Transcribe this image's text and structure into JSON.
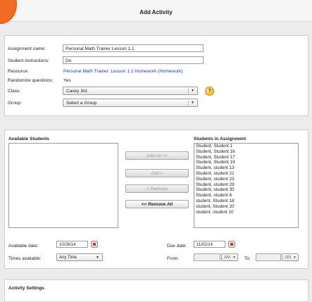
{
  "header": {
    "title": "Add Activity"
  },
  "form": {
    "assignment_name_label": "Assignment name:",
    "assignment_name_value": "Personal Math Trainer Lesson 1.1",
    "student_instructions_label": "Student instructions:",
    "student_instructions_value": "Do",
    "resource_label": "Resource:",
    "resource_value": "Personal Math Trainer: Lesson 1.1 Homework (Homework)",
    "randomize_label": "Randomize questions:",
    "randomize_value": "Yes",
    "class_label": "Class:",
    "class_value": "Casey 3rd",
    "group_label": "Group:",
    "group_value": "Select a Group",
    "help_icon": "?"
  },
  "students": {
    "available_title": "Available Students",
    "assigned_title": "Students in Assignment",
    "assigned_list": [
      "Student, Student 1",
      "Student, Student 16",
      "Student, Student 17",
      "Student, Student 19",
      "Student, student 13",
      "Student, student 21",
      "Student, student 23",
      "Student, student 29",
      "Student, student 30",
      "Student, student 6",
      "student, Student 18",
      "student, Student 20",
      "student, student 10"
    ],
    "buttons": {
      "add_all": "Add All >>",
      "add": "Add >",
      "remove": "< Remove",
      "remove_all": "<< Remove All"
    }
  },
  "dates": {
    "available_date_label": "Available date:",
    "available_date_value": "10/26/14",
    "due_date_label": "Due date:",
    "due_date_value": "11/02/14",
    "times_available_label": "Times available:",
    "times_available_value": "Any Time",
    "from_label": "From:",
    "to_label": "To:",
    "am_label": "AM"
  },
  "settings": {
    "title": "Activity Settings"
  },
  "colors": {
    "link": "#1b3fb5",
    "badge": "#f26b22"
  }
}
